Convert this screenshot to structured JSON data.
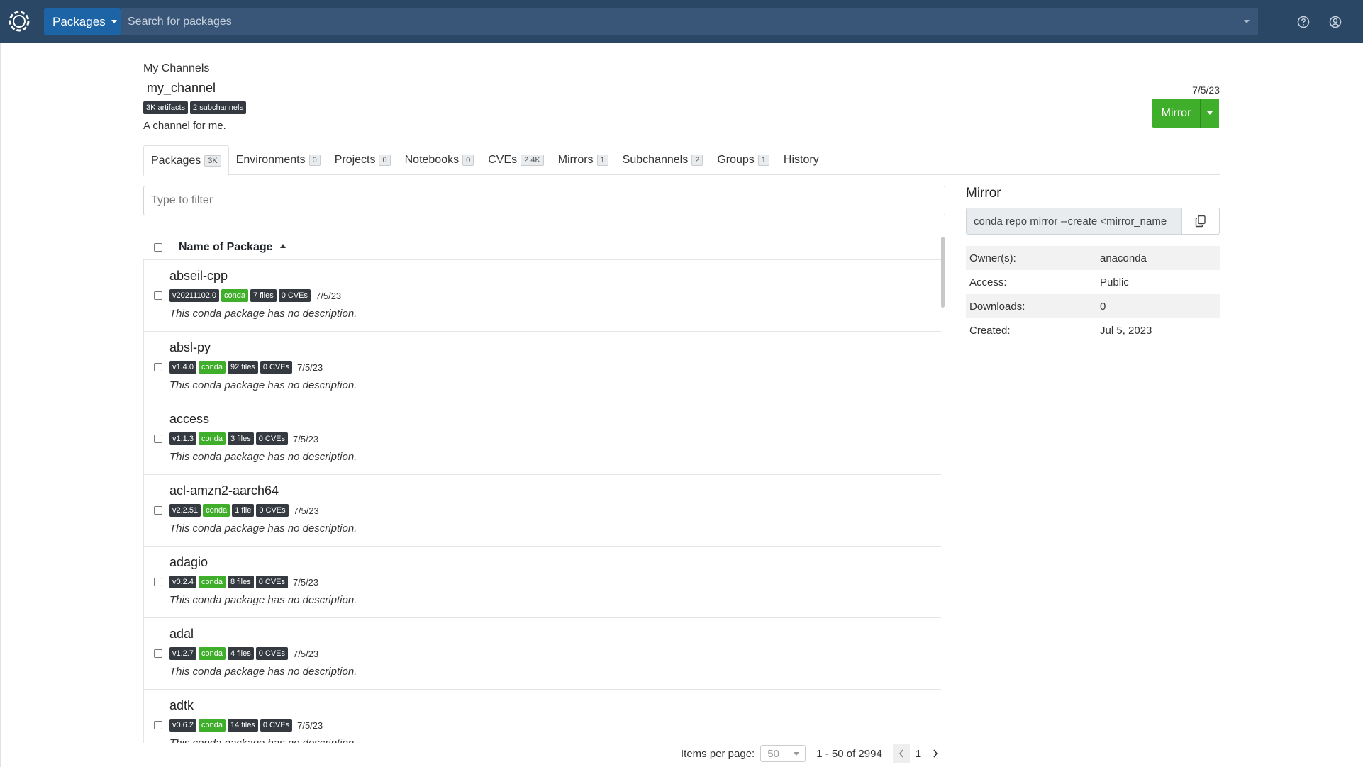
{
  "topbar": {
    "menu_label": "Packages",
    "search_placeholder": "Search for packages"
  },
  "header": {
    "breadcrumb": "My Channels",
    "channel_name": "my_channel",
    "chips": [
      "3K artifacts",
      "2 subchannels"
    ],
    "description": "A channel for me.",
    "date": "7/5/23",
    "mirror_button": "Mirror"
  },
  "tabs": [
    {
      "label": "Packages",
      "count": "3K"
    },
    {
      "label": "Environments",
      "count": "0"
    },
    {
      "label": "Projects",
      "count": "0"
    },
    {
      "label": "Notebooks",
      "count": "0"
    },
    {
      "label": "CVEs",
      "count": "2.4K"
    },
    {
      "label": "Mirrors",
      "count": "1"
    },
    {
      "label": "Subchannels",
      "count": "2"
    },
    {
      "label": "Groups",
      "count": "1"
    },
    {
      "label": "History",
      "count": ""
    }
  ],
  "filter": {
    "placeholder": "Type to filter"
  },
  "table": {
    "column_header": "Name of Package",
    "rows": [
      {
        "name": "abseil-cpp",
        "version": "v20211102.0",
        "type": "conda",
        "files": "7 files",
        "cves": "0 CVEs",
        "date": "7/5/23",
        "desc": "This conda package has no description."
      },
      {
        "name": "absl-py",
        "version": "v1.4.0",
        "type": "conda",
        "files": "92 files",
        "cves": "0 CVEs",
        "date": "7/5/23",
        "desc": "This conda package has no description."
      },
      {
        "name": "access",
        "version": "v1.1.3",
        "type": "conda",
        "files": "3 files",
        "cves": "0 CVEs",
        "date": "7/5/23",
        "desc": "This conda package has no description."
      },
      {
        "name": "acl-amzn2-aarch64",
        "version": "v2.2.51",
        "type": "conda",
        "files": "1 file",
        "cves": "0 CVEs",
        "date": "7/5/23",
        "desc": "This conda package has no description."
      },
      {
        "name": "adagio",
        "version": "v0.2.4",
        "type": "conda",
        "files": "8 files",
        "cves": "0 CVEs",
        "date": "7/5/23",
        "desc": "This conda package has no description."
      },
      {
        "name": "adal",
        "version": "v1.2.7",
        "type": "conda",
        "files": "4 files",
        "cves": "0 CVEs",
        "date": "7/5/23",
        "desc": "This conda package has no description."
      },
      {
        "name": "adtk",
        "version": "v0.6.2",
        "type": "conda",
        "files": "14 files",
        "cves": "0 CVEs",
        "date": "7/5/23",
        "desc": "This conda package has no description."
      }
    ]
  },
  "pagination": {
    "items_per_page_label": "Items per page:",
    "items_per_page": "50",
    "range": "1 - 50 of 2994",
    "page": "1"
  },
  "sidebar": {
    "title": "Mirror",
    "command": "conda repo mirror --create <mirror_name",
    "properties": [
      {
        "key": "Owner(s):",
        "value": "anaconda"
      },
      {
        "key": "Access:",
        "value": "Public"
      },
      {
        "key": "Downloads:",
        "value": "0"
      },
      {
        "key": "Created:",
        "value": "Jul 5, 2023"
      }
    ]
  },
  "colors": {
    "topbar": "#2b4766",
    "menu_button": "#1d64a6",
    "accent_green": "#3fae2a",
    "chip_dark": "#343a40"
  },
  "icons": [
    "anaconda-logo-icon",
    "help-icon",
    "user-icon",
    "copy-icon",
    "chevron-left-icon",
    "chevron-right-icon"
  ]
}
